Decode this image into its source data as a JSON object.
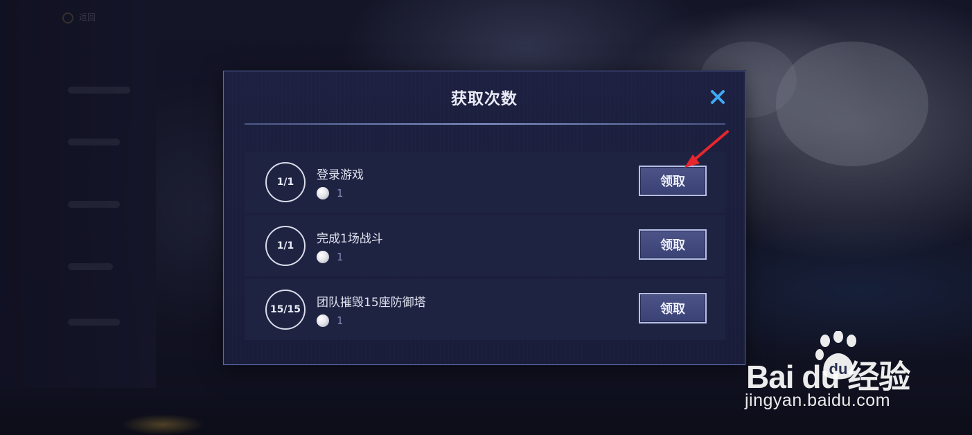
{
  "background": {
    "left_button_label": "返回"
  },
  "dialog": {
    "title": "获取次数",
    "close_icon": "close-icon",
    "tasks": [
      {
        "progress": "1/1",
        "name": "登录游戏",
        "reward_count": "1",
        "claim_label": "领取"
      },
      {
        "progress": "1/1",
        "name": "完成1场战斗",
        "reward_count": "1",
        "claim_label": "领取"
      },
      {
        "progress": "15/15",
        "name": "团队摧毁15座防御塔",
        "reward_count": "1",
        "claim_label": "领取"
      }
    ]
  },
  "colors": {
    "dialog_bg": "#1d2040",
    "dialog_border": "#5b6aa3",
    "close_icon": "#3fa9f5",
    "annotation_arrow": "#e8262d"
  },
  "watermark": {
    "brand": "Bai  du 经验",
    "url": "jingyan.baidu.com"
  }
}
